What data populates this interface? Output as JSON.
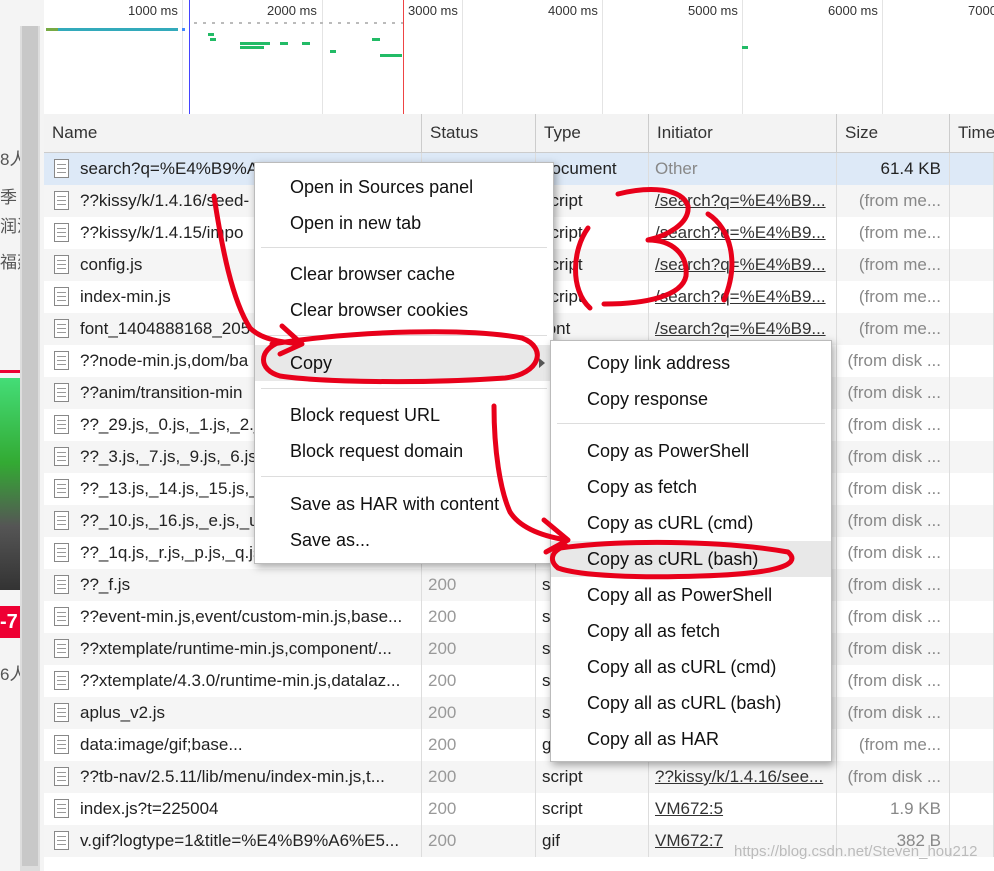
{
  "timeline": {
    "ticks": [
      "1000 ms",
      "2000 ms",
      "3000 ms",
      "4000 ms",
      "5000 ms",
      "6000 ms",
      "7000"
    ]
  },
  "columns": {
    "name": "Name",
    "status": "Status",
    "type": "Type",
    "initiator": "Initiator",
    "size": "Size",
    "time": "Time"
  },
  "rows": [
    {
      "name": "search?q=%E4%B9%A",
      "status": "",
      "type": "document",
      "initiator": "Other",
      "size": "61.4 KB"
    },
    {
      "name": "??kissy/k/1.4.16/seed-",
      "status": "",
      "type": "script",
      "initiator": "/search?q=%E4%B9...",
      "size": "(from me..."
    },
    {
      "name": "??kissy/k/1.4.15/impo",
      "status": "",
      "type": "script",
      "initiator": "/search?q=%E4%B9...",
      "size": "(from me..."
    },
    {
      "name": "config.js",
      "status": "",
      "type": "script",
      "initiator": "/search?q=%E4%B9...",
      "size": "(from me..."
    },
    {
      "name": "index-min.js",
      "status": "",
      "type": "script",
      "initiator": "/search?q=%E4%B9...",
      "size": "(from me..."
    },
    {
      "name": "font_1404888168_205",
      "status": "",
      "type": "font",
      "initiator": "/search?q=%E4%B9...",
      "size": "(from me..."
    },
    {
      "name": "??node-min.js,dom/ba",
      "status": "",
      "type": "",
      "initiator": "",
      "size": "(from disk ..."
    },
    {
      "name": "??anim/transition-min",
      "status": "",
      "type": "",
      "initiator": "",
      "size": "(from disk ..."
    },
    {
      "name": "??_29.js,_0.js,_1.js,_2.js,",
      "status": "",
      "type": "",
      "initiator": "",
      "size": "(from disk ..."
    },
    {
      "name": "??_3.js,_7.js,_9.js,_6.js,_",
      "status": "",
      "type": "",
      "initiator": "",
      "size": "(from disk ..."
    },
    {
      "name": "??_13.js,_14.js,_15.js,_1",
      "status": "",
      "type": "",
      "initiator": "",
      "size": "(from disk ..."
    },
    {
      "name": "??_10.js,_16.js,_e.js,_u.j",
      "status": "",
      "type": "",
      "initiator": "",
      "size": "(from disk ..."
    },
    {
      "name": "??_1q.js,_r.js,_p.js,_q.js,",
      "status": "",
      "type": "",
      "initiator": "",
      "size": "(from disk ..."
    },
    {
      "name": "??_f.js",
      "status": "200",
      "type": "script",
      "initiator": "",
      "size": "(from disk ..."
    },
    {
      "name": "??event-min.js,event/custom-min.js,base...",
      "status": "200",
      "type": "script",
      "initiator": "",
      "size": "(from disk ..."
    },
    {
      "name": "??xtemplate/runtime-min.js,component/...",
      "status": "200",
      "type": "script",
      "initiator": "",
      "size": "(from disk ..."
    },
    {
      "name": "??xtemplate/4.3.0/runtime-min.js,datalaz...",
      "status": "200",
      "type": "script",
      "initiator": "",
      "size": "(from disk ..."
    },
    {
      "name": "aplus_v2.js",
      "status": "200",
      "type": "script",
      "initiator": "",
      "size": "(from disk ..."
    },
    {
      "name": "data:image/gif;base...",
      "status": "200",
      "type": "gif",
      "initiator": "",
      "size": "(from me..."
    },
    {
      "name": "??tb-nav/2.5.11/lib/menu/index-min.js,t...",
      "status": "200",
      "type": "script",
      "initiator": "??kissy/k/1.4.16/see...",
      "size": "(from disk ..."
    },
    {
      "name": "index.js?t=225004",
      "status": "200",
      "type": "script",
      "initiator": "VM672:5",
      "size": "1.9 KB"
    },
    {
      "name": "v.gif?logtype=1&title=%E4%B9%A6%E5...",
      "status": "200",
      "type": "gif",
      "initiator": "VM672:7",
      "size": "382 B"
    }
  ],
  "context_menu": {
    "items": [
      "Open in Sources panel",
      "Open in new tab",
      "Clear browser cache",
      "Clear browser cookies",
      "Copy",
      "Block request URL",
      "Block request domain",
      "Save as HAR with content",
      "Save as..."
    ]
  },
  "copy_submenu": {
    "items": [
      "Copy link address",
      "Copy response",
      "Copy as PowerShell",
      "Copy as fetch",
      "Copy as cURL (cmd)",
      "Copy as cURL (bash)",
      "Copy all as PowerShell",
      "Copy all as fetch",
      "Copy all as cURL (cmd)",
      "Copy all as cURL (bash)",
      "Copy all as HAR"
    ]
  },
  "annotation": {
    "label": "(3)",
    "color": "#e8001a"
  },
  "watermark": "https://blog.csdn.net/Steven_hou212",
  "left_page": {
    "fragments": [
      "8人",
      "季",
      "润流",
      "福建",
      "6人",
      "-7"
    ]
  }
}
